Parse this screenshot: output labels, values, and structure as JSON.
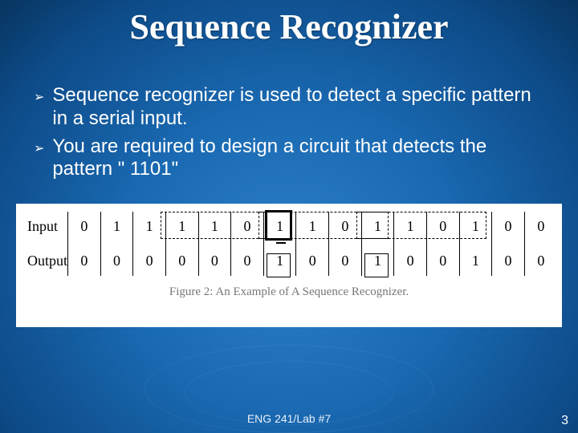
{
  "title": "Sequence Recognizer",
  "bullets": [
    "Sequence recognizer is used to detect a specific pattern in a serial input.",
    "You are required to design a circuit that detects the pattern \" 1101\""
  ],
  "figure": {
    "input_label": "Input",
    "output_label": "Output",
    "input": [
      "0",
      "1",
      "1",
      "1",
      "1",
      "0",
      "1",
      "1",
      "0",
      "1",
      "1",
      "0",
      "1",
      "0",
      "0"
    ],
    "output": [
      "0",
      "0",
      "0",
      "0",
      "0",
      "0",
      "1",
      "0",
      "0",
      "1",
      "0",
      "0",
      "1",
      "0",
      "0"
    ],
    "caption": "Figure 2: An Example of A Sequence Recognizer."
  },
  "footer": "ENG 241/Lab #7",
  "page": "3",
  "chart_data": {
    "type": "table",
    "title": "Figure 2: An Example of A Sequence Recognizer.",
    "series": [
      {
        "name": "Input",
        "values": [
          0,
          1,
          1,
          1,
          1,
          0,
          1,
          1,
          0,
          1,
          1,
          0,
          1,
          0,
          0
        ]
      },
      {
        "name": "Output",
        "values": [
          0,
          0,
          0,
          0,
          0,
          0,
          1,
          0,
          0,
          1,
          0,
          0,
          1,
          0,
          0
        ]
      }
    ],
    "highlights": {
      "input_dashed_ranges": [
        [
          3,
          6
        ],
        [
          6,
          9
        ],
        [
          9,
          12
        ]
      ],
      "input_thick_box_index": 6,
      "output_boxed_indices": [
        6,
        9
      ]
    }
  }
}
